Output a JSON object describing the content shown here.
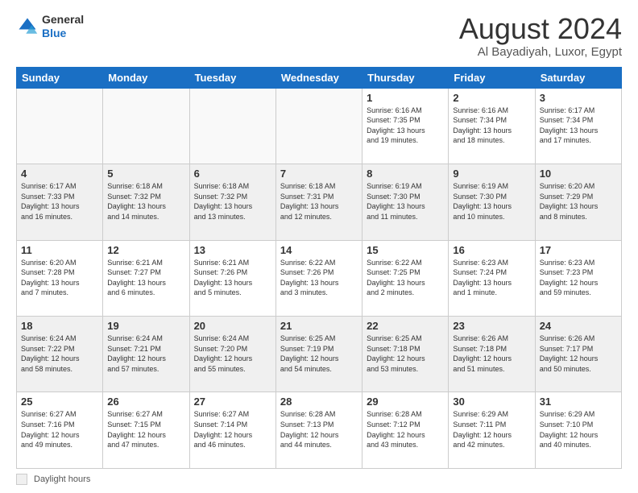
{
  "header": {
    "logo_line1": "General",
    "logo_line2": "Blue",
    "title": "August 2024",
    "subtitle": "Al Bayadiyah, Luxor, Egypt"
  },
  "calendar": {
    "days_of_week": [
      "Sunday",
      "Monday",
      "Tuesday",
      "Wednesday",
      "Thursday",
      "Friday",
      "Saturday"
    ],
    "footer_label": "Daylight hours"
  },
  "weeks": [
    [
      {
        "day": "",
        "info": "",
        "empty": true
      },
      {
        "day": "",
        "info": "",
        "empty": true
      },
      {
        "day": "",
        "info": "",
        "empty": true
      },
      {
        "day": "",
        "info": "",
        "empty": true
      },
      {
        "day": "1",
        "info": "Sunrise: 6:16 AM\nSunset: 7:35 PM\nDaylight: 13 hours\nand 19 minutes."
      },
      {
        "day": "2",
        "info": "Sunrise: 6:16 AM\nSunset: 7:34 PM\nDaylight: 13 hours\nand 18 minutes."
      },
      {
        "day": "3",
        "info": "Sunrise: 6:17 AM\nSunset: 7:34 PM\nDaylight: 13 hours\nand 17 minutes."
      }
    ],
    [
      {
        "day": "4",
        "info": "Sunrise: 6:17 AM\nSunset: 7:33 PM\nDaylight: 13 hours\nand 16 minutes."
      },
      {
        "day": "5",
        "info": "Sunrise: 6:18 AM\nSunset: 7:32 PM\nDaylight: 13 hours\nand 14 minutes."
      },
      {
        "day": "6",
        "info": "Sunrise: 6:18 AM\nSunset: 7:32 PM\nDaylight: 13 hours\nand 13 minutes."
      },
      {
        "day": "7",
        "info": "Sunrise: 6:18 AM\nSunset: 7:31 PM\nDaylight: 13 hours\nand 12 minutes."
      },
      {
        "day": "8",
        "info": "Sunrise: 6:19 AM\nSunset: 7:30 PM\nDaylight: 13 hours\nand 11 minutes."
      },
      {
        "day": "9",
        "info": "Sunrise: 6:19 AM\nSunset: 7:30 PM\nDaylight: 13 hours\nand 10 minutes."
      },
      {
        "day": "10",
        "info": "Sunrise: 6:20 AM\nSunset: 7:29 PM\nDaylight: 13 hours\nand 8 minutes."
      }
    ],
    [
      {
        "day": "11",
        "info": "Sunrise: 6:20 AM\nSunset: 7:28 PM\nDaylight: 13 hours\nand 7 minutes."
      },
      {
        "day": "12",
        "info": "Sunrise: 6:21 AM\nSunset: 7:27 PM\nDaylight: 13 hours\nand 6 minutes."
      },
      {
        "day": "13",
        "info": "Sunrise: 6:21 AM\nSunset: 7:26 PM\nDaylight: 13 hours\nand 5 minutes."
      },
      {
        "day": "14",
        "info": "Sunrise: 6:22 AM\nSunset: 7:26 PM\nDaylight: 13 hours\nand 3 minutes."
      },
      {
        "day": "15",
        "info": "Sunrise: 6:22 AM\nSunset: 7:25 PM\nDaylight: 13 hours\nand 2 minutes."
      },
      {
        "day": "16",
        "info": "Sunrise: 6:23 AM\nSunset: 7:24 PM\nDaylight: 13 hours\nand 1 minute."
      },
      {
        "day": "17",
        "info": "Sunrise: 6:23 AM\nSunset: 7:23 PM\nDaylight: 12 hours\nand 59 minutes."
      }
    ],
    [
      {
        "day": "18",
        "info": "Sunrise: 6:24 AM\nSunset: 7:22 PM\nDaylight: 12 hours\nand 58 minutes."
      },
      {
        "day": "19",
        "info": "Sunrise: 6:24 AM\nSunset: 7:21 PM\nDaylight: 12 hours\nand 57 minutes."
      },
      {
        "day": "20",
        "info": "Sunrise: 6:24 AM\nSunset: 7:20 PM\nDaylight: 12 hours\nand 55 minutes."
      },
      {
        "day": "21",
        "info": "Sunrise: 6:25 AM\nSunset: 7:19 PM\nDaylight: 12 hours\nand 54 minutes."
      },
      {
        "day": "22",
        "info": "Sunrise: 6:25 AM\nSunset: 7:18 PM\nDaylight: 12 hours\nand 53 minutes."
      },
      {
        "day": "23",
        "info": "Sunrise: 6:26 AM\nSunset: 7:18 PM\nDaylight: 12 hours\nand 51 minutes."
      },
      {
        "day": "24",
        "info": "Sunrise: 6:26 AM\nSunset: 7:17 PM\nDaylight: 12 hours\nand 50 minutes."
      }
    ],
    [
      {
        "day": "25",
        "info": "Sunrise: 6:27 AM\nSunset: 7:16 PM\nDaylight: 12 hours\nand 49 minutes."
      },
      {
        "day": "26",
        "info": "Sunrise: 6:27 AM\nSunset: 7:15 PM\nDaylight: 12 hours\nand 47 minutes."
      },
      {
        "day": "27",
        "info": "Sunrise: 6:27 AM\nSunset: 7:14 PM\nDaylight: 12 hours\nand 46 minutes."
      },
      {
        "day": "28",
        "info": "Sunrise: 6:28 AM\nSunset: 7:13 PM\nDaylight: 12 hours\nand 44 minutes."
      },
      {
        "day": "29",
        "info": "Sunrise: 6:28 AM\nSunset: 7:12 PM\nDaylight: 12 hours\nand 43 minutes."
      },
      {
        "day": "30",
        "info": "Sunrise: 6:29 AM\nSunset: 7:11 PM\nDaylight: 12 hours\nand 42 minutes."
      },
      {
        "day": "31",
        "info": "Sunrise: 6:29 AM\nSunset: 7:10 PM\nDaylight: 12 hours\nand 40 minutes."
      }
    ]
  ]
}
